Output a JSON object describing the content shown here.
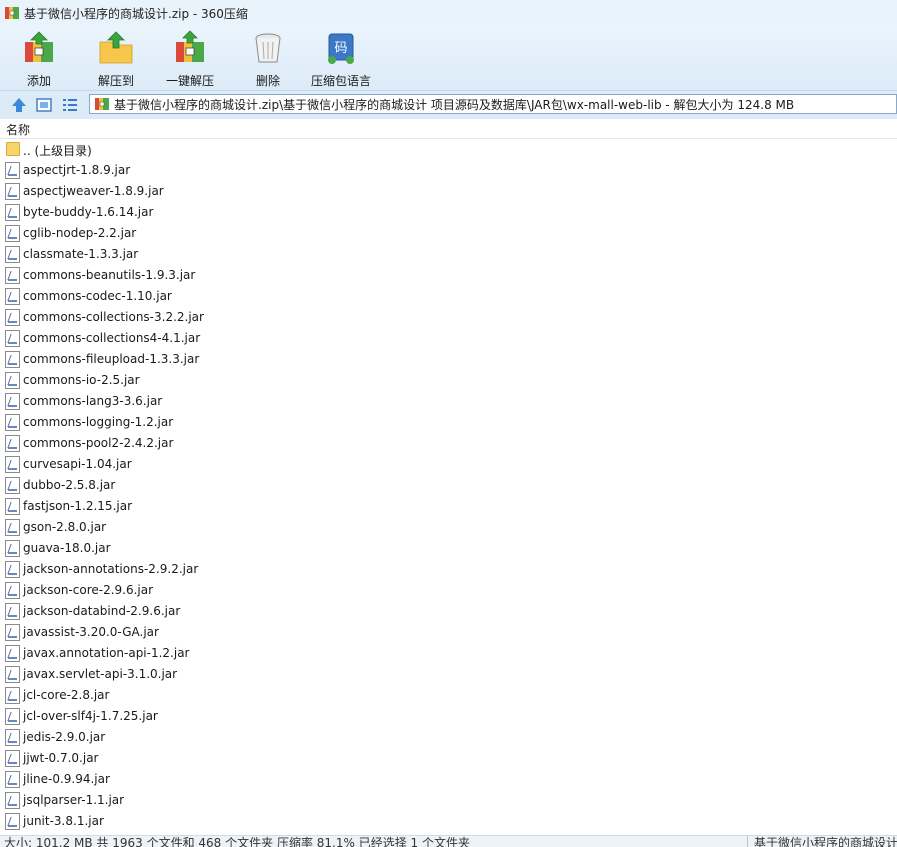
{
  "window": {
    "title": "基于微信小程序的商城设计.zip - 360压缩",
    "icon": "zip-archive-icon"
  },
  "toolbar": {
    "items": [
      {
        "label": "添加",
        "icon": "add-archive-icon"
      },
      {
        "label": "解压到",
        "icon": "extract-to-folder-icon"
      },
      {
        "label": "一键解压",
        "icon": "one-click-extract-icon"
      },
      {
        "label": "删除",
        "icon": "trash-bin-icon"
      },
      {
        "label": "压缩包语言",
        "icon": "archive-language-icon",
        "badge": "码"
      }
    ]
  },
  "address_bar": {
    "path": "基于微信小程序的商城设计.zip\\基于微信小程序的商城设计 项目源码及数据库\\JAR包\\wx-mall-web-lib - 解包大小为 124.8 MB"
  },
  "list": {
    "column_header": "名称",
    "parent_label": ".. (上级目录)",
    "files": [
      "aspectjrt-1.8.9.jar",
      "aspectjweaver-1.8.9.jar",
      "byte-buddy-1.6.14.jar",
      "cglib-nodep-2.2.jar",
      "classmate-1.3.3.jar",
      "commons-beanutils-1.9.3.jar",
      "commons-codec-1.10.jar",
      "commons-collections-3.2.2.jar",
      "commons-collections4-4.1.jar",
      "commons-fileupload-1.3.3.jar",
      "commons-io-2.5.jar",
      "commons-lang3-3.6.jar",
      "commons-logging-1.2.jar",
      "commons-pool2-2.4.2.jar",
      "curvesapi-1.04.jar",
      "dubbo-2.5.8.jar",
      "fastjson-1.2.15.jar",
      "gson-2.8.0.jar",
      "guava-18.0.jar",
      "jackson-annotations-2.9.2.jar",
      "jackson-core-2.9.6.jar",
      "jackson-databind-2.9.6.jar",
      "javassist-3.20.0-GA.jar",
      "javax.annotation-api-1.2.jar",
      "javax.servlet-api-3.1.0.jar",
      "jcl-core-2.8.jar",
      "jcl-over-slf4j-1.7.25.jar",
      "jedis-2.9.0.jar",
      "jjwt-0.7.0.jar",
      "jline-0.9.94.jar",
      "jsqlparser-1.1.jar",
      "junit-3.8.1.jar"
    ]
  },
  "status": {
    "left": "大小: 101.2 MB 共 1963 个文件和 468 个文件夹 压缩率 81.1% 已经选择 1 个文件夹",
    "right": "基于微信小程序的商城设计"
  },
  "colors": {
    "toolbar_bg": "#dcebf8",
    "titlebar_bg": "#e9f3fb",
    "folder": "#f6d36b"
  }
}
